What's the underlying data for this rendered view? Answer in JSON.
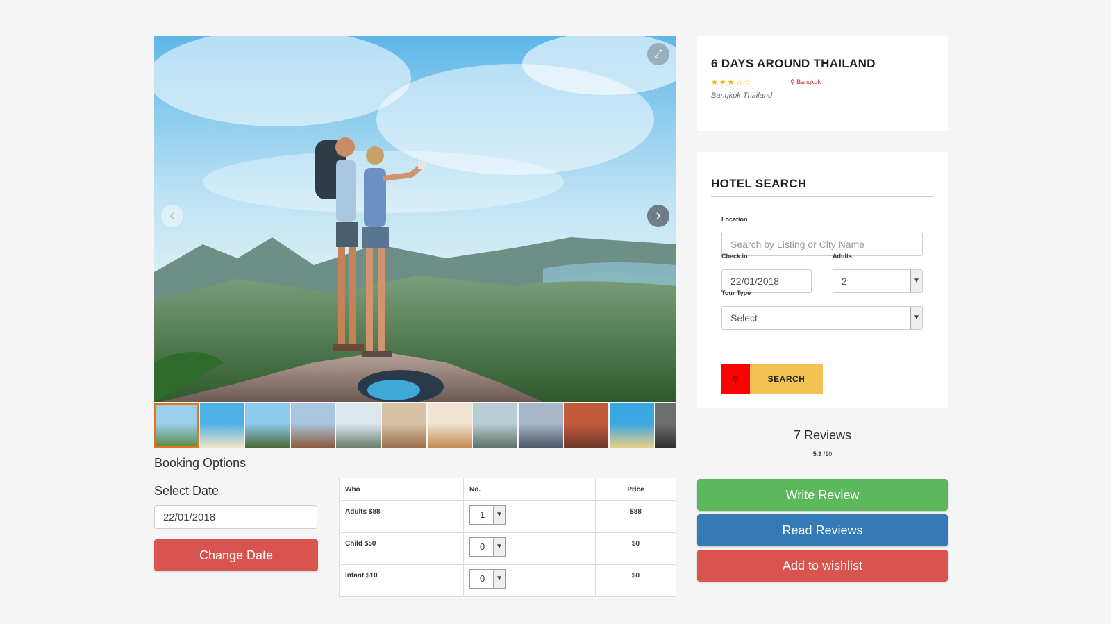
{
  "gallery": {
    "expand_icon": "expand-icon",
    "prev_icon": "chevron-left-icon",
    "next_icon": "chevron-right-icon",
    "prev_glyph": "‹",
    "next_glyph": "›",
    "expand_glyph": "⤢",
    "thumbnails": [
      {
        "name": "hikers-summit",
        "colors": [
          "#9ccfe9",
          "#5d8a4e"
        ]
      },
      {
        "name": "beach-palms",
        "colors": [
          "#4db0e4",
          "#f0e6c8"
        ]
      },
      {
        "name": "mountain-jump",
        "colors": [
          "#8ec9ee",
          "#4a6a3a"
        ]
      },
      {
        "name": "river-town",
        "colors": [
          "#a9c6df",
          "#8d5a3c"
        ]
      },
      {
        "name": "villa-pool",
        "colors": [
          "#dce8ee",
          "#6a7e6c"
        ]
      },
      {
        "name": "bedroom",
        "colors": [
          "#d8c2a6",
          "#9a6e4a"
        ]
      },
      {
        "name": "buffet-table",
        "colors": [
          "#efe5d2",
          "#c48a50"
        ]
      },
      {
        "name": "rocky-shore",
        "colors": [
          "#b7cdd3",
          "#5f7268"
        ]
      },
      {
        "name": "lakeside-houses",
        "colors": [
          "#a6b7c9",
          "#4d5666"
        ]
      },
      {
        "name": "market-stalls",
        "colors": [
          "#c45a3c",
          "#6e3828"
        ]
      },
      {
        "name": "beach-hat",
        "colors": [
          "#3aa6e2",
          "#e8cf8a"
        ]
      },
      {
        "name": "dark-landscape",
        "colors": [
          "#6d6e6e",
          "#2f2f2f"
        ]
      }
    ]
  },
  "booking": {
    "title": "Booking Options",
    "select_date_label": "Select Date",
    "date_value": "22/01/2018",
    "change_date_label": "Change Date",
    "table": {
      "headers": [
        "Who",
        "No.",
        "Price"
      ],
      "rows": [
        {
          "who": "Adults $88",
          "qty": "1",
          "price": "$88"
        },
        {
          "who": "Child $50",
          "qty": "0",
          "price": "$0"
        },
        {
          "who": "infant $10",
          "qty": "0",
          "price": "$0"
        }
      ]
    }
  },
  "tour": {
    "title": "6 DAYS AROUND THAILAND",
    "rating_stars": 3,
    "stars_filled": "★★★",
    "stars_empty": "☆☆",
    "location_pin": "📍",
    "location": "Bangkok",
    "sublocation": "Bangkok Thailand"
  },
  "hotel_search": {
    "title": "HOTEL SEARCH",
    "location_label": "Location",
    "location_placeholder": "Search by Listing or City Name",
    "checkin_label": "Check in",
    "checkin_value": "22/01/2018",
    "adults_label": "Adults",
    "adults_value": "2",
    "tour_type_label": "Tour Type",
    "tour_type_value": "Select",
    "search_label": "SEARCH",
    "search_icon": "search-icon"
  },
  "reviews": {
    "count_label": "7 Reviews",
    "score": "5.9",
    "score_max": "/10",
    "write_label": "Write Review",
    "read_label": "Read Reviews",
    "wishlist_label": "Add to wishlist"
  },
  "colors": {
    "accent_orange": "#e8731d",
    "btn_red": "#d9534f",
    "btn_green": "#5cb85c",
    "btn_blue": "#337ab7",
    "search_yellow": "#f3c254",
    "search_red": "#ff0000"
  }
}
